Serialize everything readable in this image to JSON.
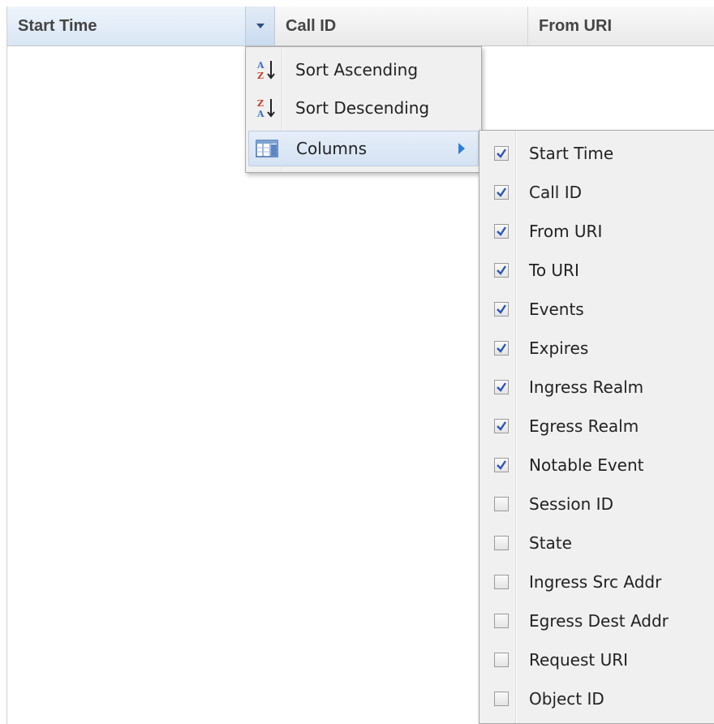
{
  "header": {
    "columns": [
      "Start Time",
      "Call ID",
      "From URI"
    ]
  },
  "menu": {
    "items": [
      {
        "label": "Sort Ascending",
        "icon": "sort-ascending-icon"
      },
      {
        "label": "Sort Descending",
        "icon": "sort-descending-icon"
      },
      {
        "label": "Columns",
        "icon": "columns-icon",
        "has_submenu": true
      }
    ]
  },
  "columns_menu": {
    "items": [
      {
        "label": "Start Time",
        "checked": true
      },
      {
        "label": "Call ID",
        "checked": true
      },
      {
        "label": "From URI",
        "checked": true
      },
      {
        "label": "To URI",
        "checked": true
      },
      {
        "label": "Events",
        "checked": true
      },
      {
        "label": "Expires",
        "checked": true
      },
      {
        "label": "Ingress Realm",
        "checked": true
      },
      {
        "label": "Egress Realm",
        "checked": true
      },
      {
        "label": "Notable Event",
        "checked": true
      },
      {
        "label": "Session ID",
        "checked": false
      },
      {
        "label": "State",
        "checked": false
      },
      {
        "label": "Ingress Src Addr",
        "checked": false
      },
      {
        "label": "Egress Dest Addr",
        "checked": false
      },
      {
        "label": "Request URI",
        "checked": false
      },
      {
        "label": "Object ID",
        "checked": false
      }
    ]
  },
  "colors": {
    "accent": "#2f7fd0",
    "check": "#2a55b8",
    "menu_bg": "#f0f0f0",
    "header_active": "#d9e6f5"
  }
}
